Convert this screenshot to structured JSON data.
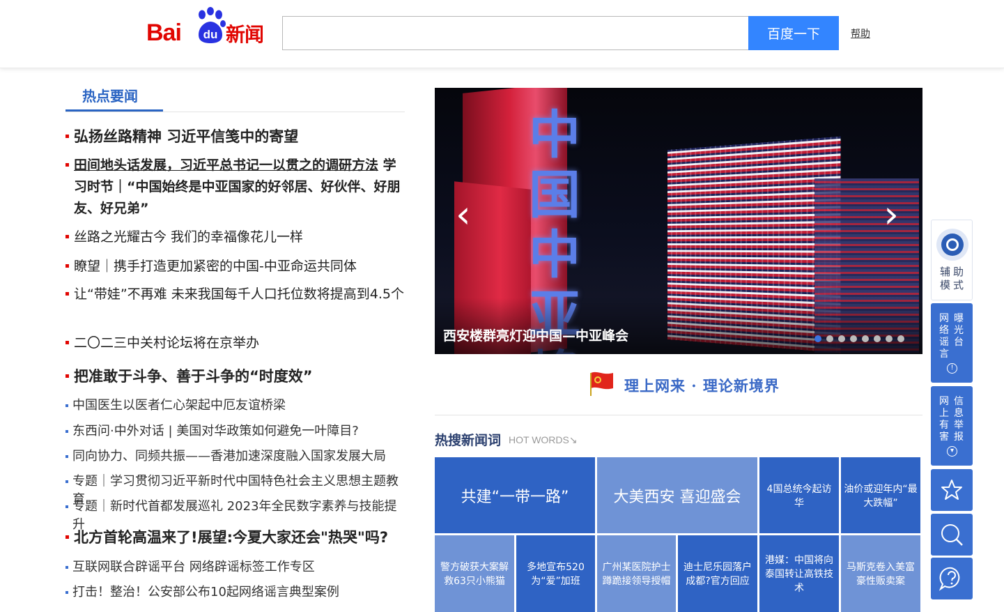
{
  "header": {
    "logo_bai": "Bai",
    "logo_du": "du",
    "logo_xinwen": "新闻",
    "search_placeholder": "",
    "search_button": "百度一下",
    "help": "帮助"
  },
  "left": {
    "tab": "热点要闻",
    "items": [
      {
        "text": "弘扬丝路精神 习近平信笺中的寄望",
        "kind": "big"
      },
      {
        "lead": "田间地头话发展，习近平总书记一以贯之的调研方法",
        "rest": " 学习时节｜“中国始终是中亚国家的好邻居、好伙伴、好朋友、好兄弟”",
        "kind": "mid-bold"
      },
      {
        "text": "丝路之光耀古今 我们的幸福像花儿一样",
        "kind": "mid"
      },
      {
        "text": "瞭望｜携手打造更加紧密的中国-中亚命运共同体",
        "kind": "mid"
      },
      {
        "text": "让“带娃”不再难 未来我国每千人口托位数将提高到4.5个",
        "kind": "mid"
      },
      {
        "text": "二〇二三中关村论坛将在京举办",
        "kind": "mid"
      },
      {
        "text": "把准敢于斗争、善于斗争的“时度效”",
        "kind": "big"
      },
      {
        "text": "中国医生以医者仁心架起中厄友谊桥梁",
        "kind": "small"
      },
      {
        "text": "东西问·中外对话 | 美国对华政策如何避免一叶障目?",
        "kind": "small"
      },
      {
        "text": "同向协力、同频共振——香港加速深度融入国家发展大局",
        "kind": "small"
      },
      {
        "text": "专题｜学习贯彻习近平新时代中国特色社会主义思想主题教育",
        "kind": "small"
      },
      {
        "text": "专题｜新时代首都发展巡礼 2023年全民数字素养与技能提升",
        "kind": "small"
      },
      {
        "text": "北方首轮高温来了!展望:今夏大家还会\"热哭\"吗?",
        "kind": "big"
      },
      {
        "text": "互联网联合辟谣平台 网络辟谣标签工作专区",
        "kind": "small"
      },
      {
        "text": "打击！整治！公安部公布10起网络谣言典型案例",
        "kind": "small"
      }
    ]
  },
  "carousel": {
    "caption": "西安楼群亮灯迎中国—中亚峰会",
    "image_text": "中国中亚峰会",
    "prev": "‹",
    "next": "›",
    "slides": 8,
    "active": 1
  },
  "banner": {
    "text": "理上网来 · 理论新境界"
  },
  "hot_words": {
    "title": "热搜新闻词",
    "subtitle": "HOT WORDS",
    "subtitle_icon": "↘",
    "cells": [
      {
        "text": "共建“一带一路”",
        "color": "#2f63c4"
      },
      {
        "text": "大美西安 喜迎盛会",
        "color": "#6f93d6"
      },
      {
        "text": "4国总统今起访华",
        "color": "#2f63c4"
      },
      {
        "text": "油价或迎年内“最大跌幅”",
        "color": "#2f63c4"
      },
      {
        "text": "警方破获大案解救63只小熊猫",
        "color": "#6f93d6"
      },
      {
        "text": "多地宣布520为“爱”加班",
        "color": "#2f63c4"
      },
      {
        "text": "广州某医院护士蹲跪接领导授帽",
        "color": "#6f93d6"
      },
      {
        "text": "迪士尼乐园落户成都?官方回应",
        "color": "#2f63c4"
      },
      {
        "text": "港媒：中国将向泰国转让高铁技术",
        "color": "#2f63c4"
      },
      {
        "text": "马斯克卷入美富豪性贩卖案",
        "color": "#6f93d6"
      }
    ]
  },
  "sidebar": {
    "assist": "辅助模式",
    "expose_a": "网络谣言",
    "expose_b": "曝光台",
    "expose_icon": "!",
    "report_a": "网上有害",
    "report_b": "信息举报",
    "report_icon": "▾"
  },
  "colors": {
    "brand_red": "#e10602",
    "accent_blue": "#3385ff",
    "side_blue": "#3a6fd0"
  }
}
